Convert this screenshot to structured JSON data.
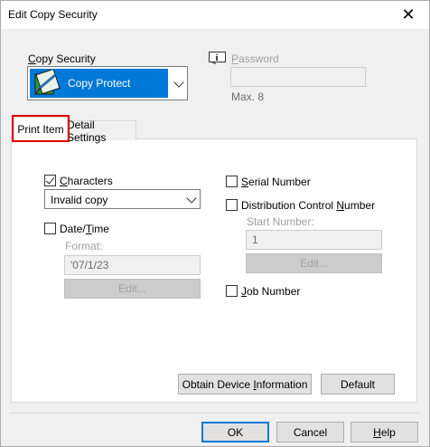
{
  "window": {
    "title": "Edit Copy Security",
    "close_glyph": "✕"
  },
  "copy_security": {
    "label": "Copy Security",
    "selected": "Copy Protect",
    "selected_bg": "#0078d7"
  },
  "password": {
    "label": "Password",
    "value": "",
    "hint": "Max. 8"
  },
  "tabs": [
    {
      "label": "Print Item",
      "active": true
    },
    {
      "label": "Detail Settings",
      "active": false
    }
  ],
  "print_item": {
    "characters": {
      "label": "Characters",
      "checked": true,
      "value": "Invalid copy"
    },
    "date_time": {
      "label": "Date/Time",
      "checked": false,
      "format_label": "Format:",
      "format_value": "'07/1/23",
      "edit_label": "Edit..."
    },
    "serial_number": {
      "label": "Serial Number",
      "checked": false
    },
    "distribution_control_number": {
      "label": "Distribution Control Number",
      "checked": false,
      "start_label": "Start Number:",
      "start_value": "1",
      "edit_label": "Edit..."
    },
    "job_number": {
      "label": "Job Number",
      "checked": false
    },
    "obtain_button": "Obtain Device Information",
    "default_button": "Default"
  },
  "footer": {
    "ok": "OK",
    "cancel": "Cancel",
    "help": "Help"
  },
  "colors": {
    "highlight": "#e00000",
    "accent": "#0078d7"
  }
}
